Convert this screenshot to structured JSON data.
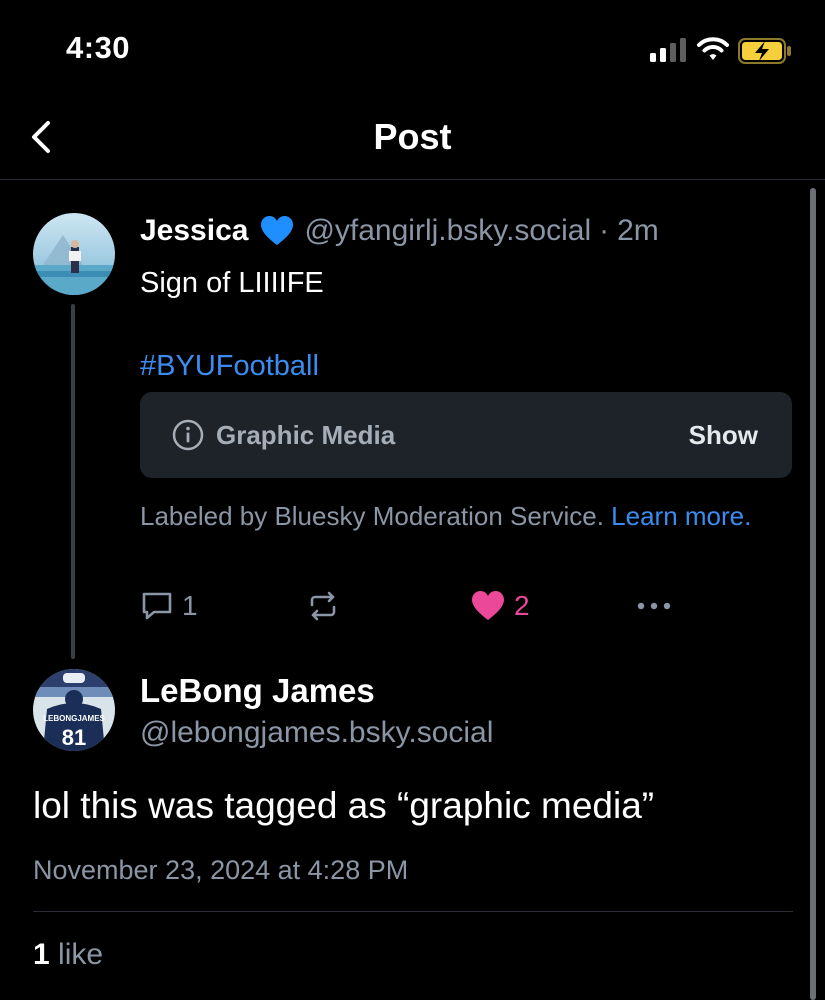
{
  "status_bar": {
    "time": "4:30"
  },
  "header": {
    "title": "Post"
  },
  "parent_post": {
    "author_name": "Jessica",
    "handle": "@yfangirlj.bsky.social",
    "separator": "·",
    "time_ago": "2m",
    "text": "Sign of LIIIIFE",
    "hashtag": "#BYUFootball",
    "label_warning": {
      "label": "Graphic Media",
      "show": "Show"
    },
    "labeled_by": "Labeled by Bluesky Moderation Service.",
    "learn_more": "Learn more.",
    "replies": "1",
    "likes": "2"
  },
  "main_post": {
    "author_name": "LeBong James",
    "handle": "@lebongjames.bsky.social",
    "text": "lol this was tagged as “graphic media”",
    "date": "November 23, 2024 at 4:28 PM",
    "like_count": "1",
    "like_word": "like",
    "jersey_name": "LEBONGJAMES",
    "jersey_number": "81"
  },
  "colors": {
    "accent_blue": "#3b8cf0",
    "like_pink": "#ec4899",
    "muted_text": "#8a96a5",
    "heart_emoji_blue": "#1f8fff",
    "battery_yellow": "#f5d03c"
  }
}
